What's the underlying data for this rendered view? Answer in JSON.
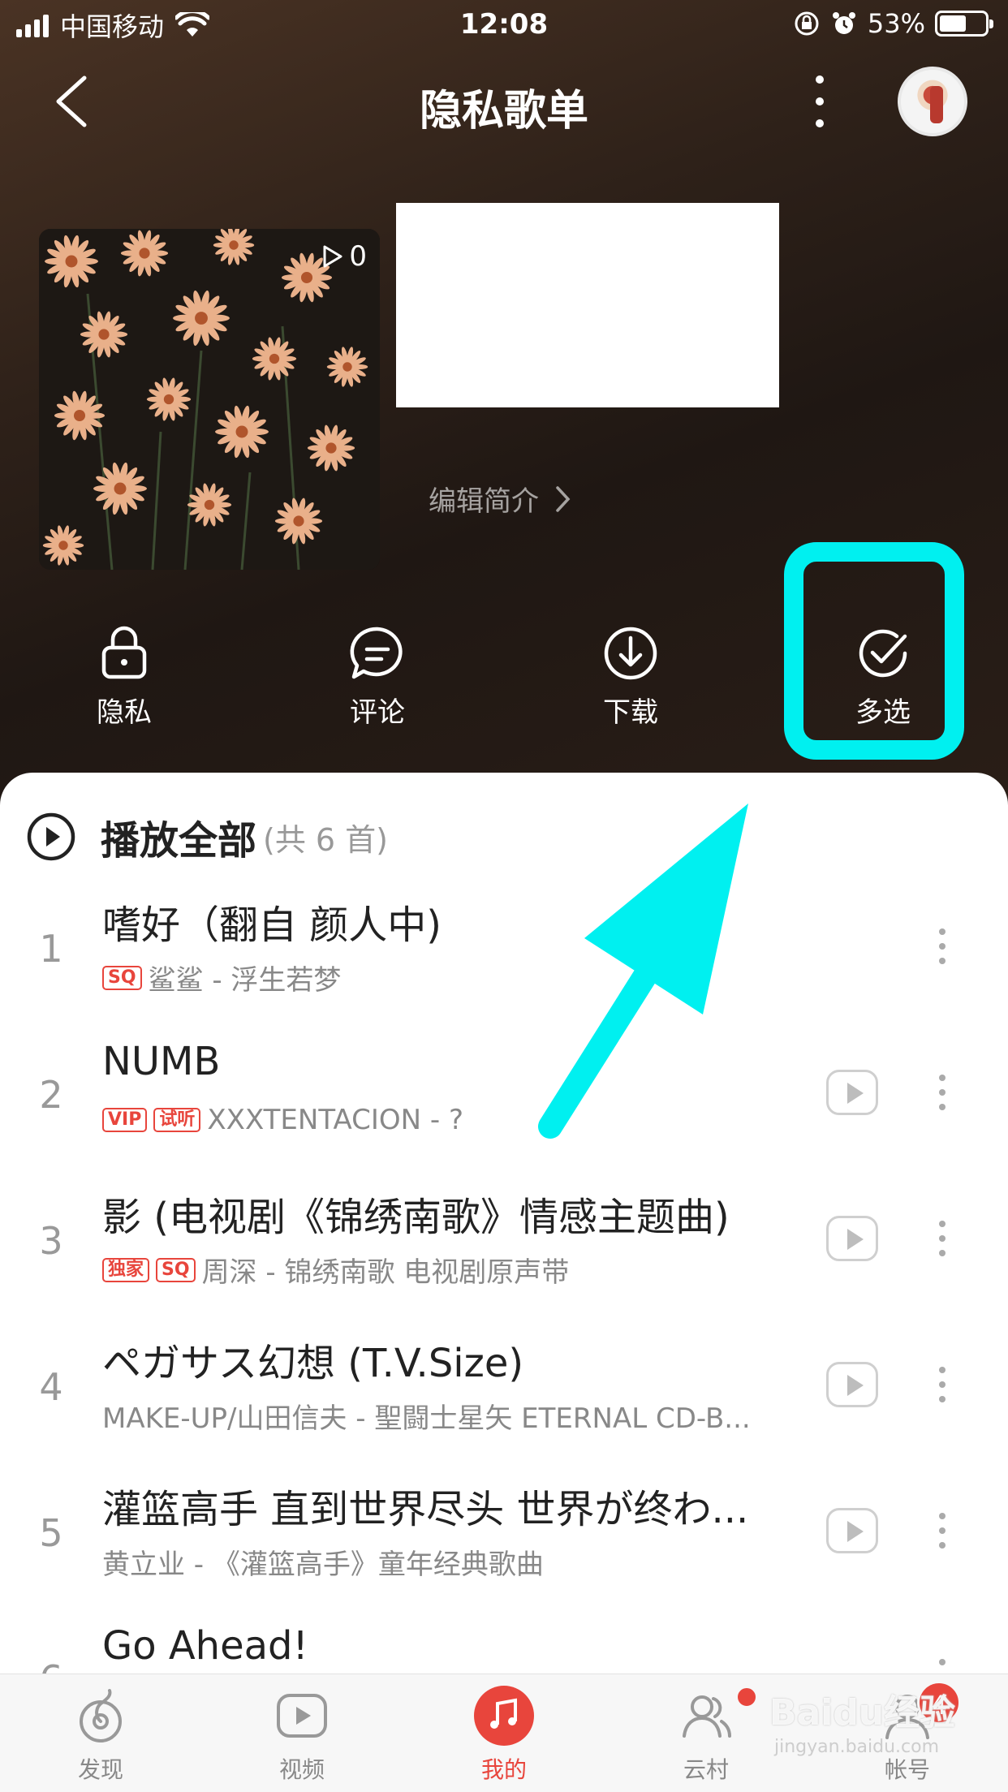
{
  "status_bar": {
    "carrier": "中国移动",
    "time": "12:08",
    "battery": "53%"
  },
  "nav": {
    "title": "隐私歌单"
  },
  "playlist": {
    "play_count": "0",
    "edit_intro": "编辑简介"
  },
  "actions": [
    {
      "label": "隐私",
      "icon": "lock-icon"
    },
    {
      "label": "评论",
      "icon": "comment-icon"
    },
    {
      "label": "下载",
      "icon": "download-icon"
    },
    {
      "label": "多选",
      "icon": "multi-select-icon"
    }
  ],
  "list": {
    "play_all": "播放全部",
    "count": "(共 6 首)",
    "songs": [
      {
        "num": "1",
        "title": "嗜好（翻自 颜人中)",
        "tags": [
          "SQ"
        ],
        "sub": "鲨鲨 - 浮生若梦",
        "has_mv": false
      },
      {
        "num": "2",
        "title": "NUMB",
        "tags": [
          "VIP",
          "试听"
        ],
        "sub": "XXXTENTACION - ?",
        "has_mv": true
      },
      {
        "num": "3",
        "title": "影 (电视剧《锦绣南歌》情感主题曲)",
        "tags": [
          "独家",
          "SQ"
        ],
        "sub": "周深 - 锦绣南歌 电视剧原声带",
        "has_mv": true
      },
      {
        "num": "4",
        "title": "ペガサス幻想 (T.V.Size)",
        "tags": [],
        "sub": "MAKE-UP/山田信夫 - 聖闘士星矢 ETERNAL CD-B...",
        "has_mv": true
      },
      {
        "num": "5",
        "title": "灌篮高手 直到世界尽头 世界が终わ...",
        "tags": [],
        "sub": "黄立业 - 《灌篮高手》童年经典歌曲",
        "has_mv": true
      },
      {
        "num": "6",
        "title": "Go Ahead!",
        "tags": [],
        "sub": "",
        "has_mv": false
      }
    ]
  },
  "tabs": [
    {
      "label": "发现",
      "icon": "discover-icon"
    },
    {
      "label": "视频",
      "icon": "video-icon"
    },
    {
      "label": "我的",
      "icon": "music-note-icon"
    },
    {
      "label": "云村",
      "icon": "community-icon"
    },
    {
      "label": "帐号",
      "icon": "account-icon",
      "badge": "4"
    }
  ],
  "watermark": {
    "brand": "Baidu经验",
    "url": "jingyan.baidu.com"
  },
  "colors": {
    "accent": "#e8453c",
    "highlight": "#00f0f0",
    "header_bg": "#2a1e17"
  }
}
